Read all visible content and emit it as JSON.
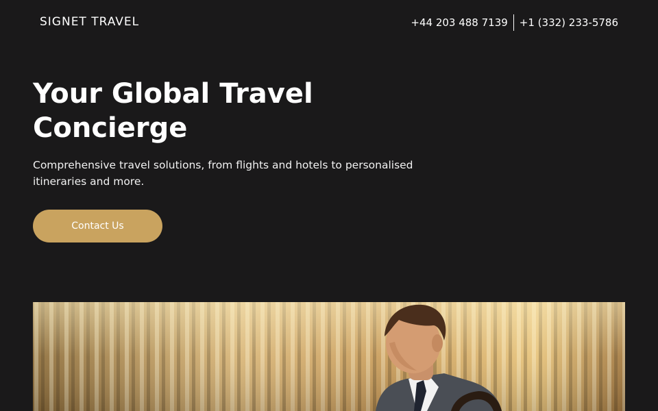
{
  "header": {
    "logo_text": "SIGNET TRAVEL",
    "phone_uk": "+44 203 488 7139",
    "phone_us": "+1 (332) 233-5786"
  },
  "hero": {
    "title_line1": "Your Global Travel",
    "title_line2": "Concierge",
    "subtitle": "Comprehensive travel solutions, from flights and hotels to personalised itineraries and more.",
    "cta_label": "Contact Us",
    "image_description": "Businessman in suit in front of golden curtains"
  },
  "colors": {
    "background": "#1a191a",
    "accent": "#c9a35f",
    "text": "#ffffff"
  }
}
